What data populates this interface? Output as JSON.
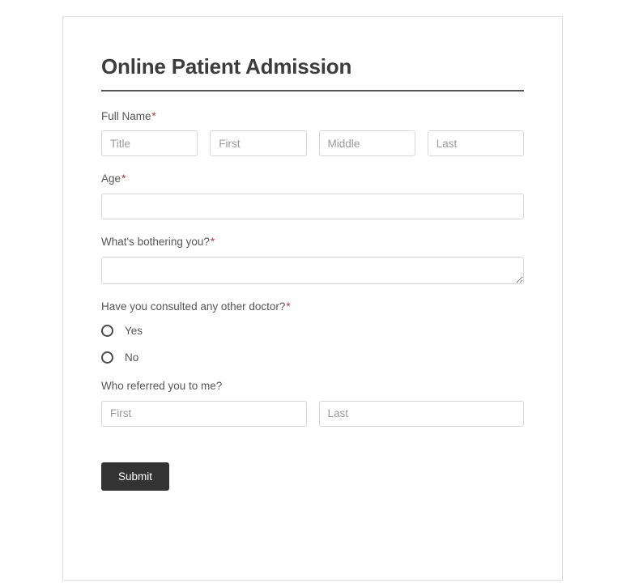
{
  "form": {
    "title": "Online Patient Admission",
    "required_marker": "*",
    "fields": {
      "full_name": {
        "label": "Full Name",
        "required": true,
        "parts": [
          {
            "name": "title",
            "placeholder": "Title",
            "value": ""
          },
          {
            "name": "first",
            "placeholder": "First",
            "value": ""
          },
          {
            "name": "middle",
            "placeholder": "Middle",
            "value": ""
          },
          {
            "name": "last",
            "placeholder": "Last",
            "value": ""
          }
        ]
      },
      "age": {
        "label": "Age",
        "required": true,
        "placeholder": "",
        "value": ""
      },
      "complaint": {
        "label": "What's bothering you?",
        "required": true,
        "placeholder": "",
        "value": ""
      },
      "consulted_other_doctor": {
        "label": "Have you consulted any other doctor?",
        "required": true,
        "selected": "",
        "options": [
          {
            "value": "yes",
            "label": "Yes"
          },
          {
            "value": "no",
            "label": "No"
          }
        ]
      },
      "referrer": {
        "label": "Who referred you to me?",
        "required": false,
        "parts": [
          {
            "name": "first",
            "placeholder": "First",
            "value": ""
          },
          {
            "name": "last",
            "placeholder": "Last",
            "value": ""
          }
        ]
      }
    },
    "submit_label": "Submit"
  },
  "colors": {
    "accent_required": "#b33b3b",
    "button_bg": "#333333",
    "title_text": "#3c3c3c",
    "label_text": "#555555",
    "input_border": "#d8d8d8",
    "card_border": "#e0e0e0"
  }
}
